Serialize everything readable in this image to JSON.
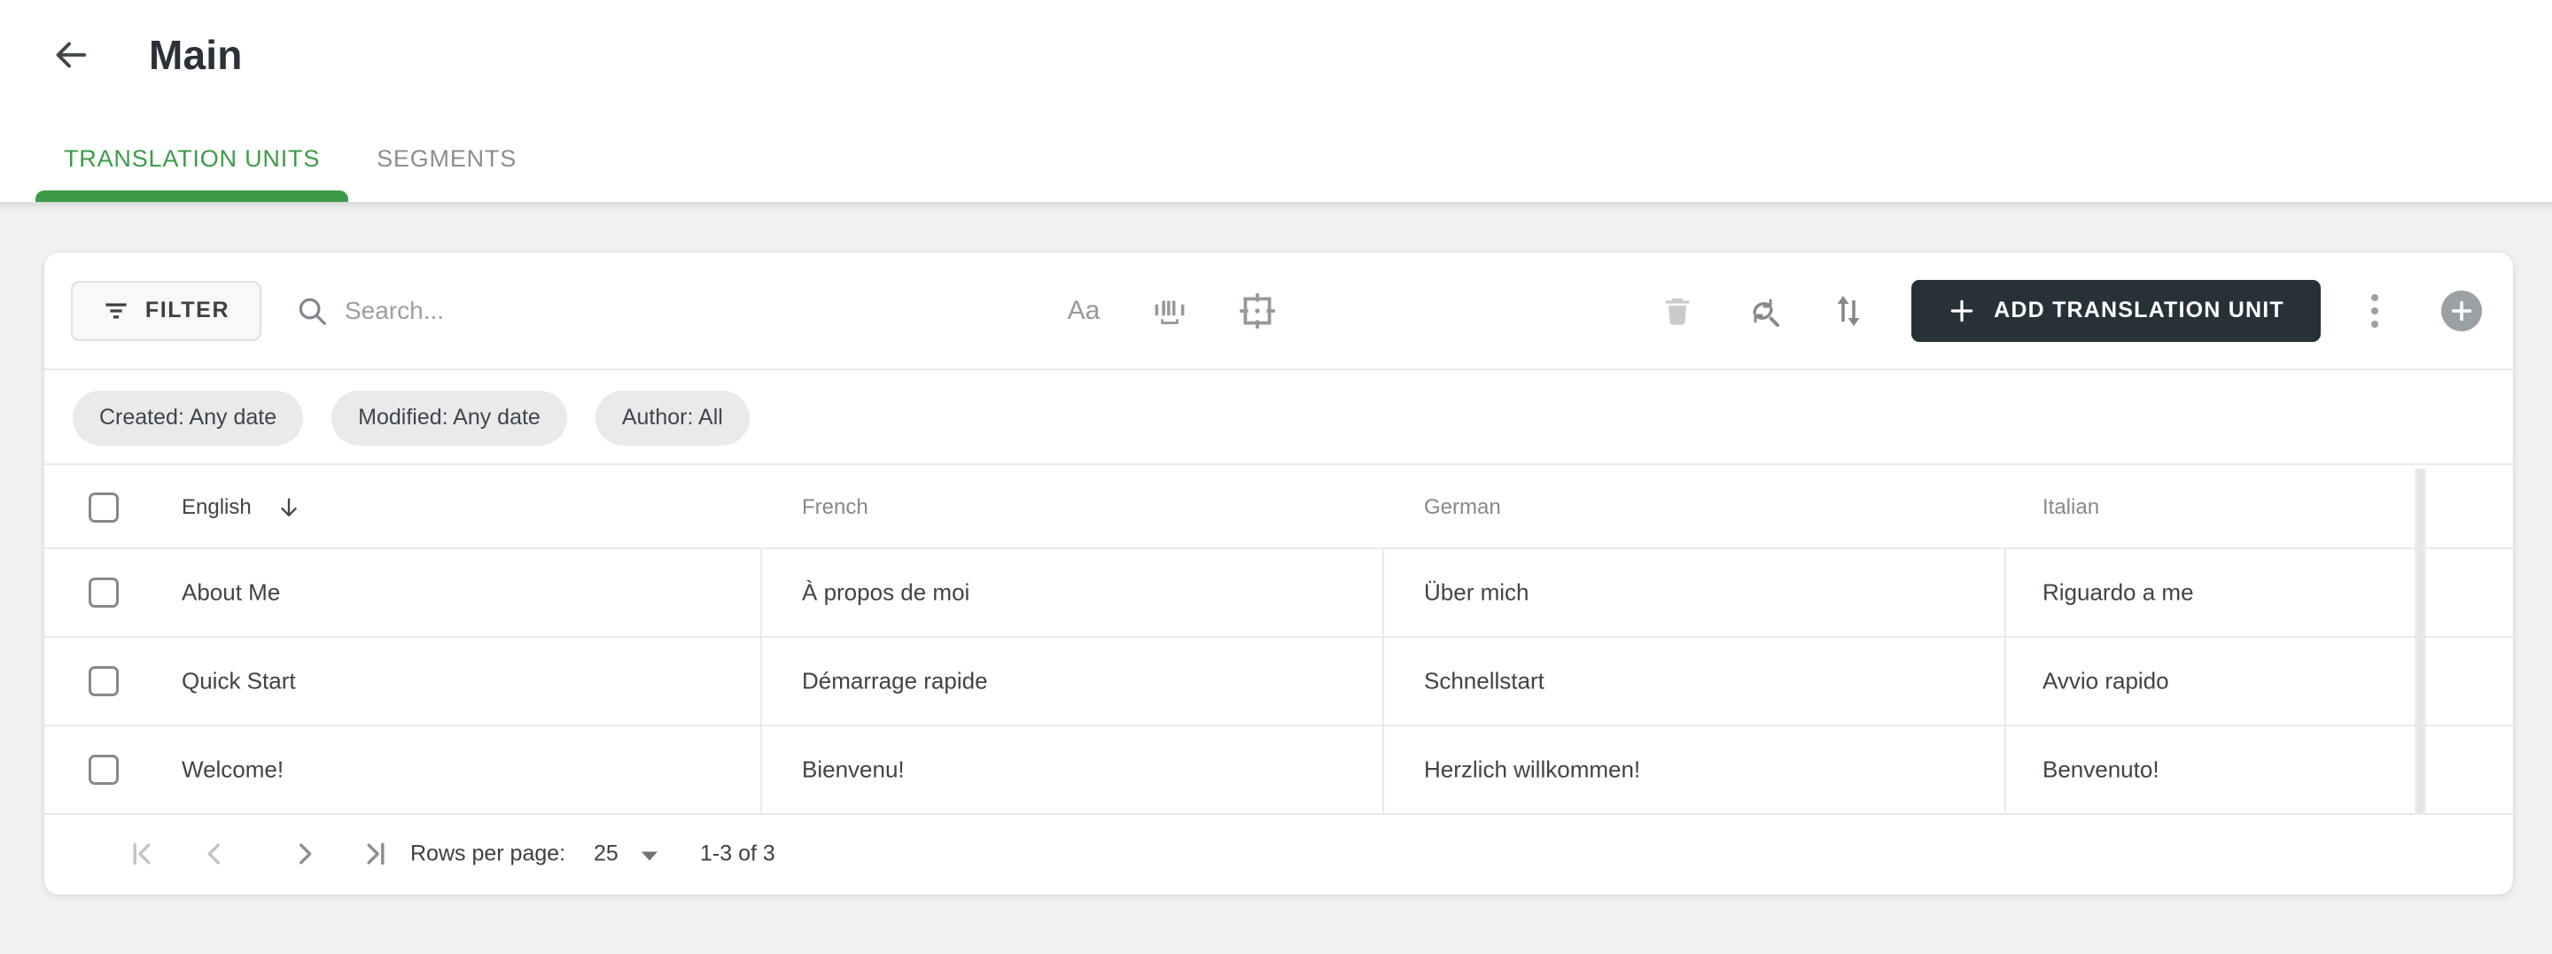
{
  "header": {
    "title": "Main"
  },
  "tabs": [
    {
      "label": "TRANSLATION UNITS",
      "active": true
    },
    {
      "label": "SEGMENTS",
      "active": false
    }
  ],
  "toolbar": {
    "filter_label": "FILTER",
    "search_placeholder": "Search...",
    "match_case_glyph": "Aa",
    "add_label": "ADD TRANSLATION UNIT",
    "icons": [
      "filter-icon",
      "search-icon",
      "match-case-icon",
      "barcode-icon",
      "crop-focus-icon",
      "trash-icon",
      "find-replace-icon",
      "sort-arrows-icon",
      "plus-icon",
      "kebab-menu-icon",
      "fab-plus-icon"
    ]
  },
  "filter_chips": [
    {
      "label": "Created: Any date"
    },
    {
      "label": "Modified: Any date"
    },
    {
      "label": "Author: All"
    }
  ],
  "table": {
    "columns": [
      {
        "label": "English",
        "sort": "desc"
      },
      {
        "label": "French",
        "sort": null
      },
      {
        "label": "German",
        "sort": null
      },
      {
        "label": "Italian",
        "sort": null
      }
    ],
    "rows": [
      {
        "english": "About Me",
        "french": "À propos de moi",
        "german": "Über mich",
        "italian": "Riguardo a me",
        "selected": false
      },
      {
        "english": "Quick Start",
        "french": "Démarrage rapide",
        "german": "Schnellstart",
        "italian": "Avvio rapido",
        "selected": false
      },
      {
        "english": "Welcome!",
        "french": "Bienvenu!",
        "german": "Herzlich willkommen!",
        "italian": "Benvenuto!",
        "selected": false
      }
    ]
  },
  "pagination": {
    "rows_per_page_label": "Rows per page:",
    "rows_per_page_value": "25",
    "range_label": "1-3 of 3"
  },
  "colors": {
    "accent_green": "#3d9b47",
    "primary_button_bg": "#263238",
    "chip_bg": "#e9eaec",
    "text_primary": "#3f4449",
    "text_secondary": "#85898d"
  }
}
